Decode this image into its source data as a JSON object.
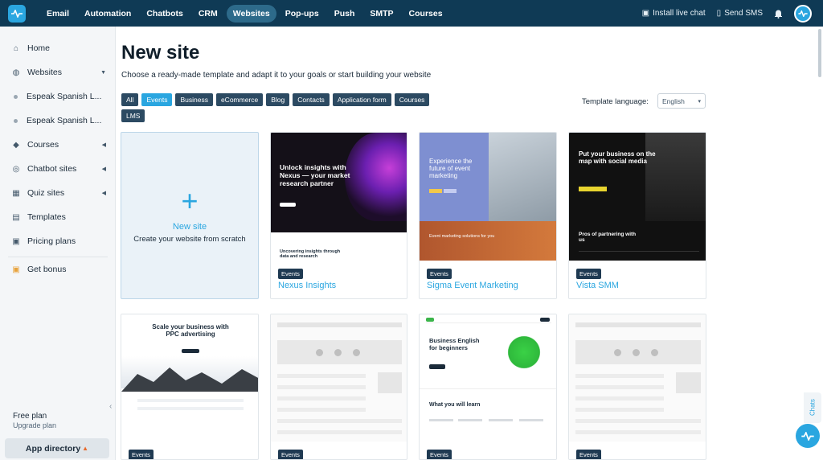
{
  "nav": {
    "items": [
      "Email",
      "Automation",
      "Chatbots",
      "CRM",
      "Websites",
      "Pop-ups",
      "Push",
      "SMTP",
      "Courses"
    ],
    "active": "Websites",
    "install_live_chat": "Install live chat",
    "send_sms": "Send SMS"
  },
  "sidebar": {
    "items": [
      {
        "label": "Home",
        "icon": "home-icon"
      },
      {
        "label": "Websites",
        "icon": "globe-icon"
      },
      {
        "label": "Espeak Spanish L...",
        "icon": "dot"
      },
      {
        "label": "Espeak Spanish L...",
        "icon": "dot"
      },
      {
        "label": "Courses",
        "icon": "graduation-cap-icon"
      },
      {
        "label": "Chatbot sites",
        "icon": "chatbot-icon"
      },
      {
        "label": "Quiz sites",
        "icon": "quiz-icon"
      },
      {
        "label": "Templates",
        "icon": "templates-icon"
      },
      {
        "label": "Pricing plans",
        "icon": "pricing-icon"
      },
      {
        "label": "Get bonus",
        "icon": "gift-icon"
      }
    ],
    "free_plan": "Free plan",
    "upgrade_plan": "Upgrade plan",
    "app_directory": "App directory"
  },
  "page": {
    "title": "New site",
    "subtitle": "Choose a ready-made template and adapt it to your goals or start building your website"
  },
  "filters": [
    "All",
    "Events",
    "Business",
    "eCommerce",
    "Blog",
    "Contacts",
    "Application form",
    "Courses",
    "LMS"
  ],
  "active_filter": "Events",
  "template_language": {
    "label": "Template language:",
    "value": "English"
  },
  "new_site": {
    "label": "New site",
    "description": "Create your website from scratch"
  },
  "templates": [
    {
      "name": "Nexus Insights",
      "tag": "Events",
      "thumb_text": "Unlock insights with Nexus — your market research partner",
      "thumb_sub": "Uncovering insights through data and research"
    },
    {
      "name": "Sigma Event Marketing",
      "tag": "Events",
      "thumb_text": "Experience the future of event marketing",
      "thumb_sub": "Event marketing solutions for you"
    },
    {
      "name": "Vista SMM",
      "tag": "Events",
      "thumb_text": "Put your business on the map with social media",
      "thumb_sub": "Pros of partnering with us"
    }
  ],
  "templates_row2": [
    {
      "tag": "Events",
      "thumb_text": "Scale your business with PPC advertising"
    },
    {
      "tag": "Events",
      "thumb_text": ""
    },
    {
      "tag": "Events",
      "thumb_text": "Business English for beginners",
      "thumb_sub": "What you will learn"
    },
    {
      "tag": "Events",
      "thumb_text": ""
    }
  ],
  "chats_label": "Chats",
  "colors": {
    "nav_bg": "#0f3a55",
    "accent": "#2aa6e0",
    "tag_bg": "#1f3a52"
  }
}
